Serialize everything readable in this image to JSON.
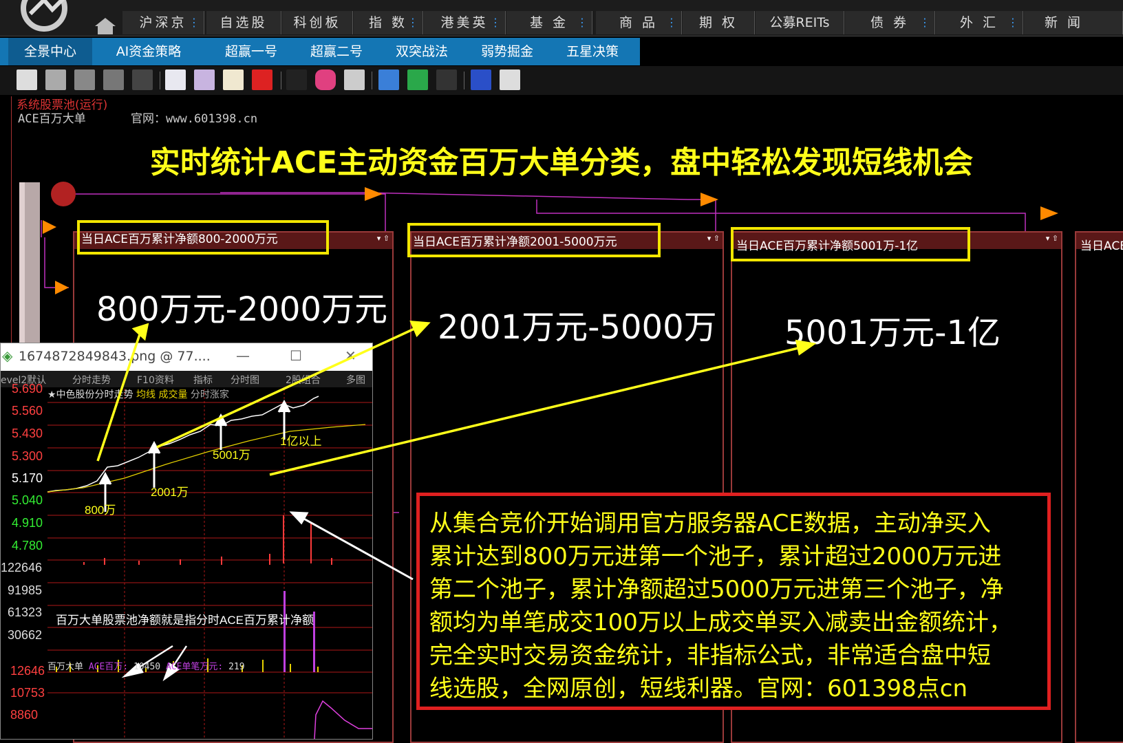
{
  "top_nav": {
    "tabs": [
      {
        "label": "沪深京",
        "dots": "⋮"
      },
      {
        "label": "自选股",
        "dots": ""
      },
      {
        "label": "科创板",
        "dots": ""
      },
      {
        "label": "指 数",
        "dots": "⋮"
      },
      {
        "label": "港美英",
        "dots": "⋮"
      },
      {
        "label": "基 金",
        "dots": "⋮"
      },
      {
        "label": "商 品",
        "dots": "⋮"
      },
      {
        "label": "期 权",
        "dots": ""
      },
      {
        "label": "公募REITs",
        "dots": ""
      },
      {
        "label": "债 券",
        "dots": "⋮"
      },
      {
        "label": "外 汇",
        "dots": "⋮"
      },
      {
        "label": "新 闻",
        "dots": ""
      }
    ]
  },
  "sub_nav": {
    "tabs": [
      "全景中心",
      "AI资金策略",
      "超赢一号",
      "超赢二号",
      "双突战法",
      "弱势掘金",
      "五星决策"
    ]
  },
  "canvas": {
    "header": "系统股票池(运行)",
    "title": "ACE百万大单",
    "site": "官网：www.601398.cn",
    "headline": "实时统计ACE主动资金百万大单分类，盘中轻松发现短线机会"
  },
  "pools": [
    {
      "label": "当日ACE百万累计净额800-2000万元",
      "range": "800万元-2000万元"
    },
    {
      "label": "当日ACE百万累计净额2001-5000万元",
      "range": "2001万元-5000万"
    },
    {
      "label": "当日ACE百万累计净额5001万-1亿",
      "range": "5001万元-1亿"
    },
    {
      "label": "当日ACE",
      "range": ""
    }
  ],
  "inset": {
    "window_title": "1674872849843.png @ 77....",
    "menu": [
      "evel2默认",
      "分时走势",
      "F10资料",
      "指标",
      "分时图",
      "2股组合",
      "多图"
    ],
    "stock_title": "★中色股份分时走势",
    "legend": [
      "均线",
      "成交量",
      "分时涨家"
    ],
    "price_labels": [
      "5.690",
      "5.560",
      "5.430",
      "5.300",
      "5.170",
      "5.040",
      "4.910",
      "4.780"
    ],
    "volume_labels": [
      "122646",
      "91985",
      "61323",
      "30662"
    ],
    "ace_labels": [
      "12646",
      "10753",
      "8860"
    ],
    "annotations": {
      "a800": "800万",
      "a2001": "2001万",
      "a5001": "5001万",
      "a1yi": "1亿以上",
      "pool_note": "百万大单股票池净额就是指分时ACE百万累计净额"
    },
    "ace_bar": {
      "prefix": "百万大单",
      "item1": "ACE百万:",
      "value1": "10450",
      "item2": "ACE单笔万元:",
      "value2": "219"
    },
    "colors": {
      "up": "#ff3b3b",
      "down": "#22dd22",
      "line": "#ffffff",
      "avg": "#e6d200"
    }
  },
  "explain": {
    "lines": [
      "从集合竞价开始调用官方服务器ACE数据，主动净买入",
      "累计达到800万元进第一个池子，累计超过2000万元进",
      "第二个池子，累计净额超过5000万元进第三个池子，净",
      "额均为单笔成交100万以上成交单买入减卖出金额统计，",
      "完全实时交易资金统计，非指标公式，非常适合盘中短",
      "线选股，全网原创，短线利器。官网：601398点cn"
    ]
  }
}
